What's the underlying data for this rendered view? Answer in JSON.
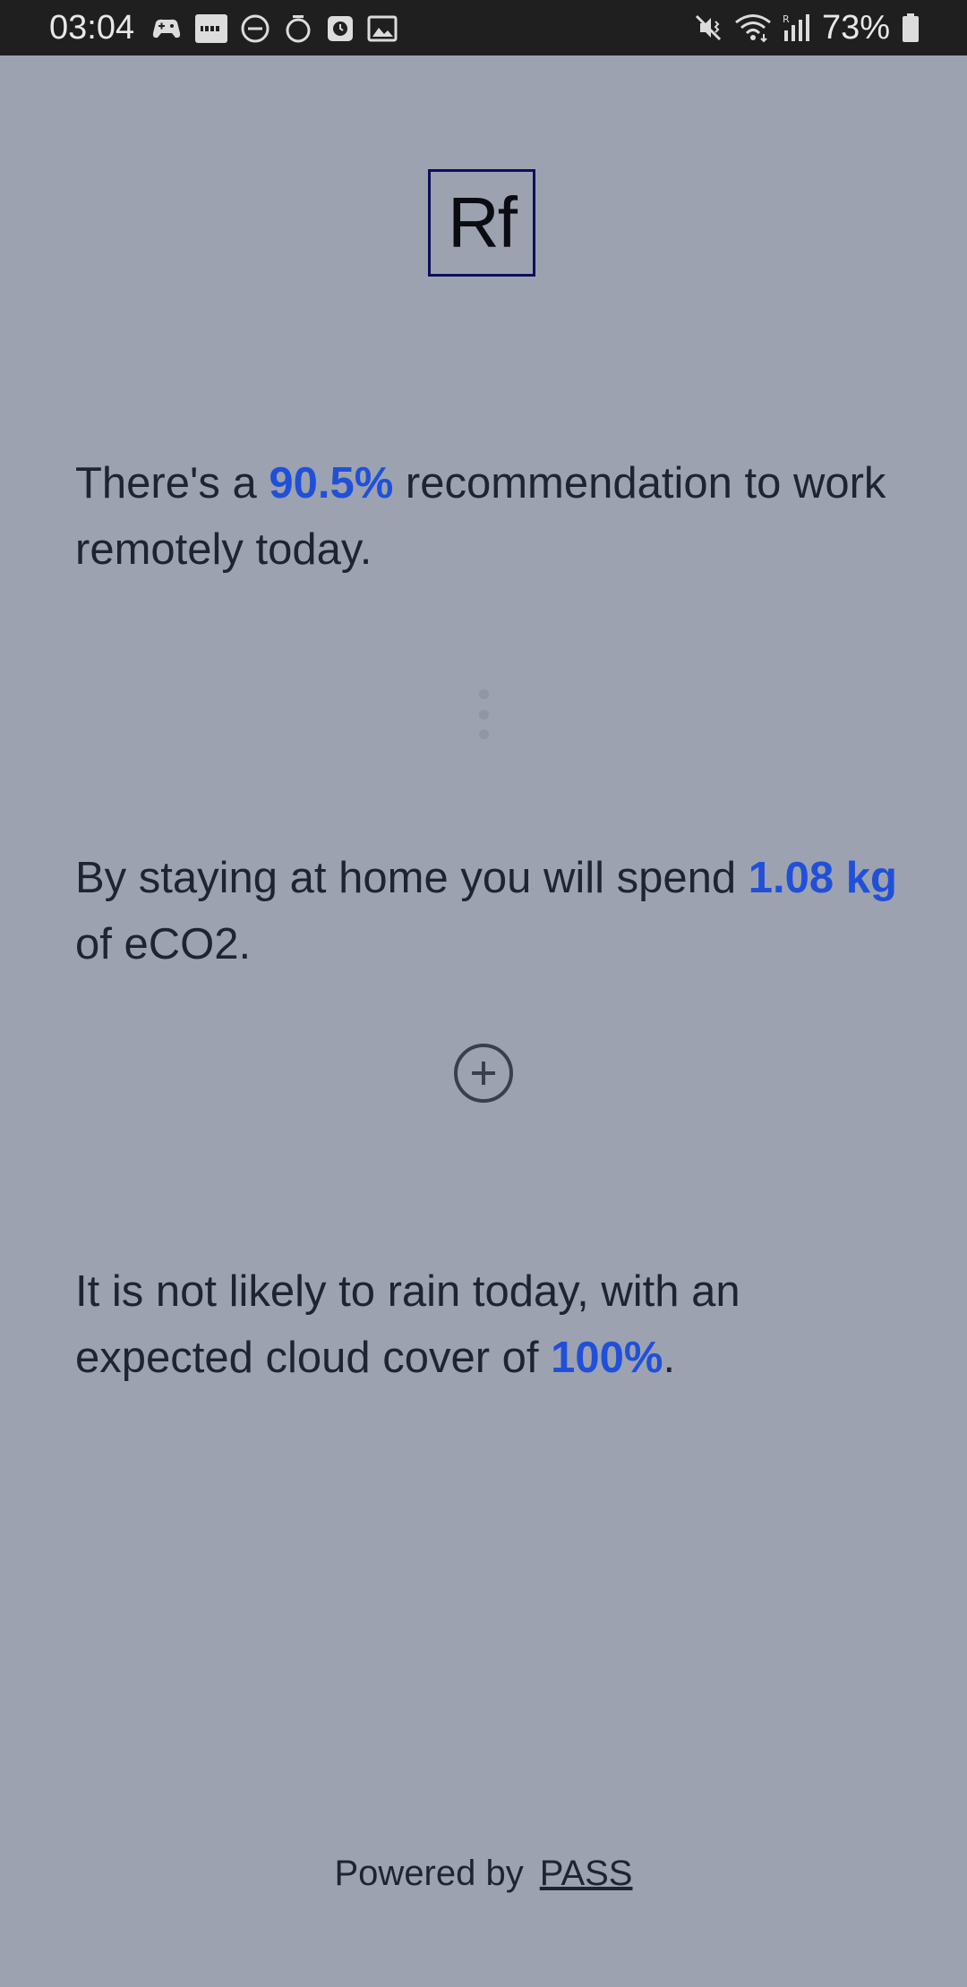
{
  "status_bar": {
    "time": "03:04",
    "battery": "73%",
    "left_icons": [
      "game-controller-icon",
      "ifttt-icon",
      "do-not-disturb-icon",
      "alarm-timer-icon",
      "clock-app-icon",
      "gallery-image-icon"
    ],
    "right_icons": [
      "mute-vibrate-icon",
      "wifi-icon",
      "signal-icon",
      "battery-icon"
    ]
  },
  "logo": {
    "text": "Rf"
  },
  "recommendation": {
    "prefix": "There's a ",
    "value": "90.5%",
    "suffix": " recommendation to work remotely today."
  },
  "emission": {
    "prefix": "By staying at home you will spend ",
    "value": "1.08 kg",
    "suffix": " of eCO2."
  },
  "weather": {
    "prefix": "It is not likely to rain today, with an expected cloud cover of ",
    "value": "100%",
    "suffix": "."
  },
  "footer": {
    "powered_by": "Powered by",
    "link_text": "PASS"
  },
  "colors": {
    "background": "#9ca2b0",
    "highlight": "#2050d8",
    "status_bar": "#1f1f1f",
    "logo_border": "#0e0f5c"
  }
}
